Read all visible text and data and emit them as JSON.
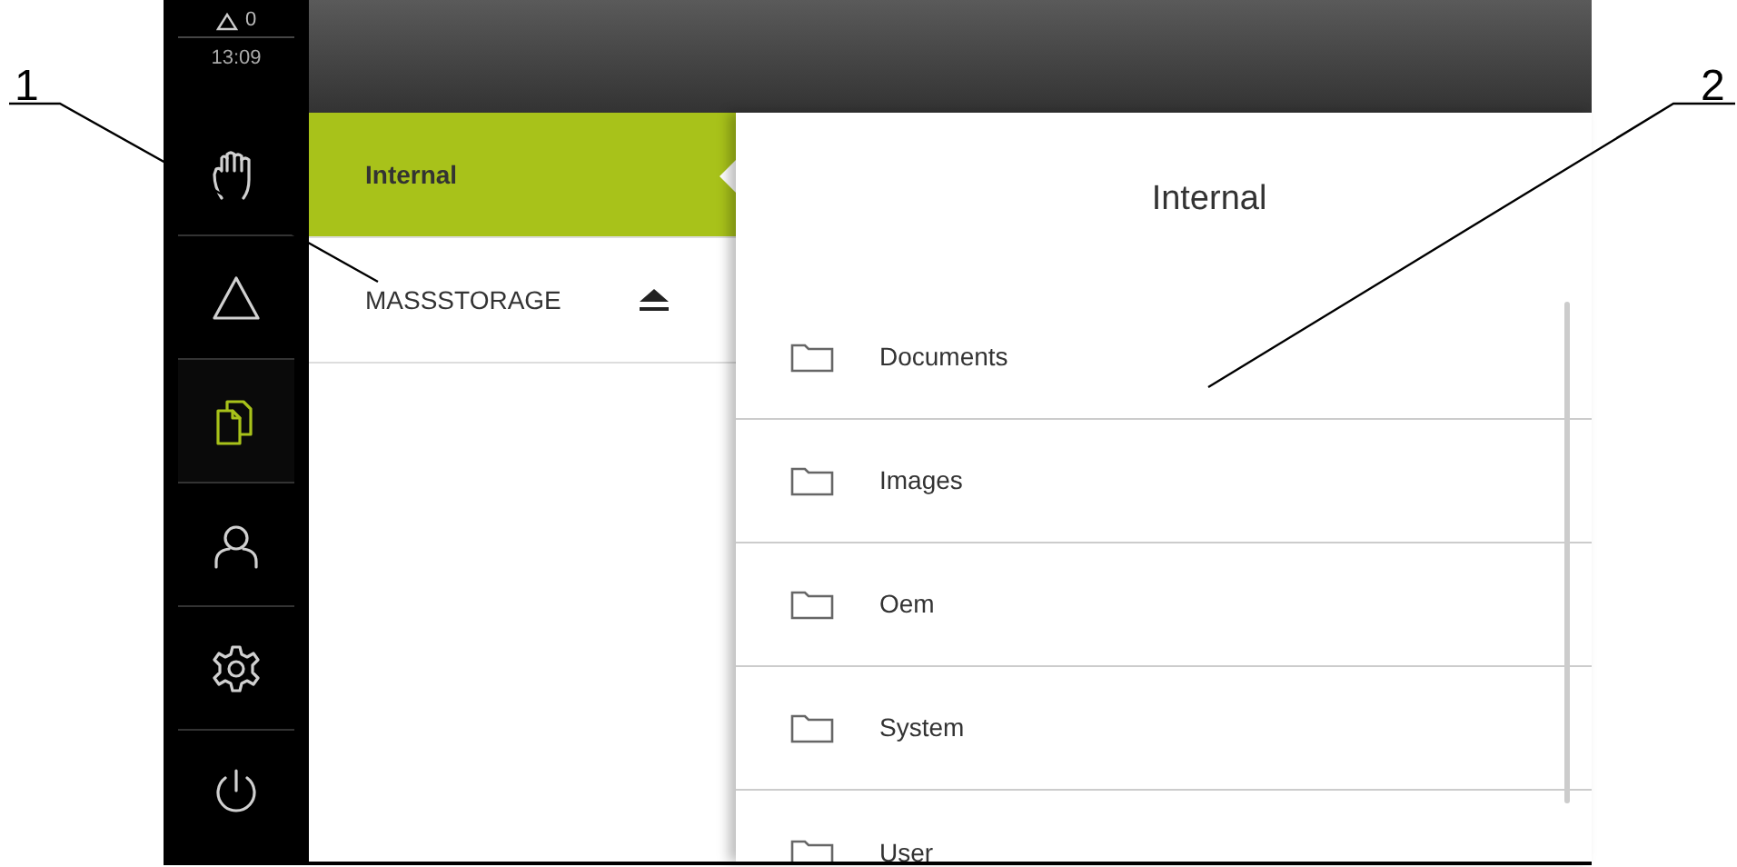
{
  "status": {
    "alarm_count": "0",
    "time": "13:09"
  },
  "sidebar": {
    "items": [
      {
        "selected": false
      },
      {
        "selected": false
      },
      {
        "selected": true
      },
      {
        "selected": false
      },
      {
        "selected": false
      },
      {
        "selected": false
      }
    ]
  },
  "storage_list": [
    {
      "label": "Internal",
      "selected": true,
      "eject": false
    },
    {
      "label": "MASSSTORAGE",
      "selected": false,
      "eject": true
    }
  ],
  "folder_panel": {
    "title": "Internal",
    "folders": [
      {
        "name": "Documents"
      },
      {
        "name": "Images"
      },
      {
        "name": "Oem"
      },
      {
        "name": "System"
      },
      {
        "name": "User"
      }
    ]
  },
  "callouts": [
    {
      "label": "1"
    },
    {
      "label": "2"
    }
  ]
}
